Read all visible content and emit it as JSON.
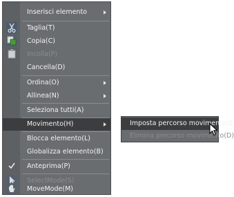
{
  "menu": {
    "items": [
      {
        "label": "Inserisci elemento",
        "submenu": true
      },
      {
        "label": "Taglia(T)"
      },
      {
        "label": "Copia(C)"
      },
      {
        "label": "Incolla(P)",
        "disabled": true
      },
      {
        "label": "Cancella(D)"
      },
      {
        "label": "Ordina(O)",
        "submenu": true
      },
      {
        "label": "Allinea(N)",
        "submenu": true
      },
      {
        "label": "Seleziona tutti(A)"
      },
      {
        "label": "Movimento(H)",
        "submenu": true,
        "active": true
      },
      {
        "label": "Blocca elemento(L)"
      },
      {
        "label": "Globalizza elemento(B)"
      },
      {
        "label": "Anteprima(P)",
        "checked": true
      },
      {
        "label": "SelectMode(S)",
        "disabled": true
      },
      {
        "label": "MoveMode(M)"
      }
    ]
  },
  "submenu": {
    "items": [
      {
        "label": "Imposta percorso movimento(S)"
      },
      {
        "label": "Elimina percorso movimento(D)",
        "disabled": true
      }
    ]
  },
  "icons": {
    "cut": "scissors-icon",
    "copy": "copy-icon",
    "paste": "paste-icon",
    "check": "check-icon",
    "select_mode": "arrow-pointer-icon",
    "move_mode": "hand-icon"
  },
  "colors": {
    "menu_bg": "#6a6d70",
    "gutter_bg": "#5e6164",
    "highlight_bg": "#3b3d3f",
    "text": "#f2f2f2",
    "disabled_text": "#8a8d90"
  }
}
